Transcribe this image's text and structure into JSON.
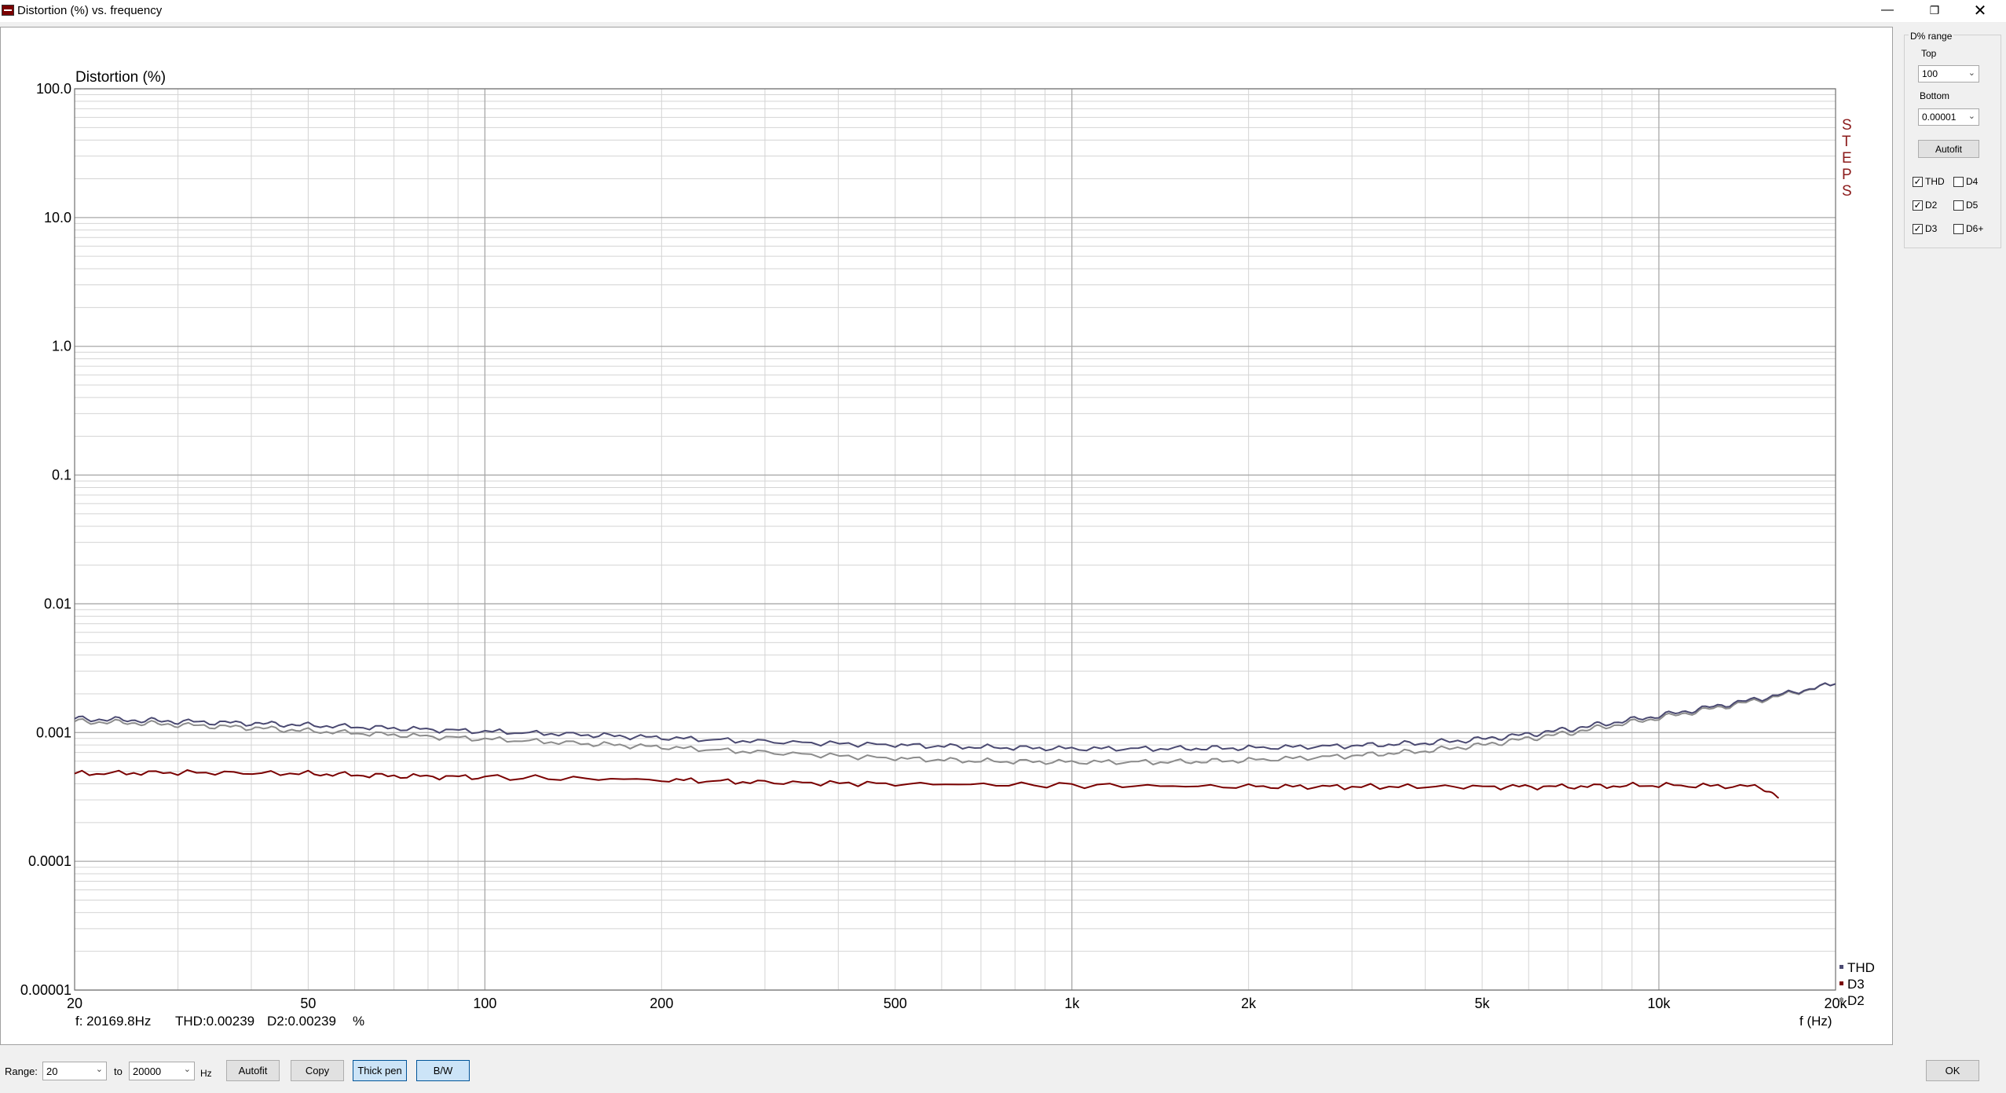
{
  "window": {
    "title": "Distortion (%) vs. frequency",
    "minimize_glyph": "—",
    "maximize_glyph": "❐",
    "close_glyph": "✕"
  },
  "side_panel": {
    "group_label": "D% range",
    "top_label": "Top",
    "top_value": "100",
    "bottom_label": "Bottom",
    "bottom_value": "0.00001",
    "autofit_label": "Autofit",
    "checkboxes": [
      {
        "label": "THD",
        "checked": true
      },
      {
        "label": "D4",
        "checked": false
      },
      {
        "label": "D2",
        "checked": true
      },
      {
        "label": "D5",
        "checked": false
      },
      {
        "label": "D3",
        "checked": true
      },
      {
        "label": "D6+",
        "checked": false
      }
    ]
  },
  "bottom_bar": {
    "range_label": "Range:",
    "range_from": "20",
    "to_label": "to",
    "range_to": "20000",
    "unit_label": "Hz",
    "autofit_label": "Autofit",
    "copy_label": "Copy",
    "thick_pen_label": "Thick pen",
    "bw_label": "B/W",
    "ok_label": "OK"
  },
  "colors": {
    "THD": "#4b4a72",
    "D2": "#8c8c8c",
    "D3": "#7a0000",
    "grid_major": "#a8a8a8",
    "grid_minor": "#d4d4d4",
    "steps": "#8b1a1a"
  },
  "chart_data": {
    "type": "line",
    "ylabel": "Distortion (%)",
    "xlabel": "f (Hz)",
    "x_scale": "log",
    "y_scale": "log",
    "xlim": [
      20,
      20000
    ],
    "ylim": [
      1e-05,
      100
    ],
    "x_ticks": [
      {
        "value": 20,
        "label": "20"
      },
      {
        "value": 50,
        "label": "50"
      },
      {
        "value": 100,
        "label": "100"
      },
      {
        "value": 200,
        "label": "200"
      },
      {
        "value": 500,
        "label": "500"
      },
      {
        "value": 1000,
        "label": "1k"
      },
      {
        "value": 2000,
        "label": "2k"
      },
      {
        "value": 5000,
        "label": "5k"
      },
      {
        "value": 10000,
        "label": "10k"
      },
      {
        "value": 20000,
        "label": "20k"
      }
    ],
    "y_ticks": [
      {
        "value": 100,
        "label": "100.0"
      },
      {
        "value": 10,
        "label": "10.0"
      },
      {
        "value": 1,
        "label": "1.0"
      },
      {
        "value": 0.1,
        "label": "0.1"
      },
      {
        "value": 0.01,
        "label": "0.01"
      },
      {
        "value": 0.001,
        "label": "0.001"
      },
      {
        "value": 0.0001,
        "label": "0.0001"
      },
      {
        "value": 1e-05,
        "label": "0.00001"
      }
    ],
    "grid": true,
    "steps_label": [
      "S",
      "T",
      "E",
      "P",
      "S"
    ],
    "legend_position": "bottom-right",
    "readout": {
      "freq": "f: 20169.8Hz",
      "thd": "THD:0.00239",
      "d2": "D2:0.00239",
      "unit": "%"
    },
    "series": [
      {
        "name": "THD",
        "x": [
          20,
          25,
          30,
          40,
          50,
          70,
          100,
          150,
          200,
          300,
          500,
          700,
          1000,
          1500,
          2000,
          3000,
          4000,
          5000,
          6000,
          7000,
          8000,
          10000,
          12000,
          15000,
          20000
        ],
        "values": [
          0.00128,
          0.00125,
          0.00122,
          0.00118,
          0.00114,
          0.00108,
          0.00102,
          0.00096,
          0.00091,
          0.00085,
          0.0008,
          0.00077,
          0.00075,
          0.00075,
          0.00076,
          0.00079,
          0.00083,
          0.00089,
          0.00097,
          0.00106,
          0.00116,
          0.00135,
          0.00155,
          0.00185,
          0.00239
        ]
      },
      {
        "name": "D2",
        "x": [
          20,
          25,
          30,
          40,
          50,
          70,
          100,
          150,
          200,
          300,
          500,
          700,
          1000,
          1500,
          2000,
          3000,
          4000,
          5000,
          6000,
          7000,
          8000,
          10000,
          12000,
          15000,
          20000
        ],
        "values": [
          0.00122,
          0.00119,
          0.00115,
          0.00109,
          0.00103,
          0.00096,
          0.00089,
          0.00082,
          0.00077,
          0.0007,
          0.00063,
          0.0006,
          0.00059,
          0.00059,
          0.00061,
          0.00066,
          0.00072,
          0.0008,
          0.0009,
          0.00099,
          0.0011,
          0.0013,
          0.0015,
          0.0018,
          0.00239
        ]
      },
      {
        "name": "D3",
        "x": [
          20,
          30,
          50,
          70,
          100,
          200,
          300,
          500,
          1000,
          2000,
          3000,
          5000,
          7000,
          10000,
          15000,
          16000
        ],
        "values": [
          0.00048,
          0.00049,
          0.00048,
          0.00046,
          0.00045,
          0.00043,
          0.00041,
          0.0004,
          0.00039,
          0.00038,
          0.00038,
          0.00038,
          0.00038,
          0.00039,
          0.00038,
          0.00031
        ]
      }
    ]
  }
}
